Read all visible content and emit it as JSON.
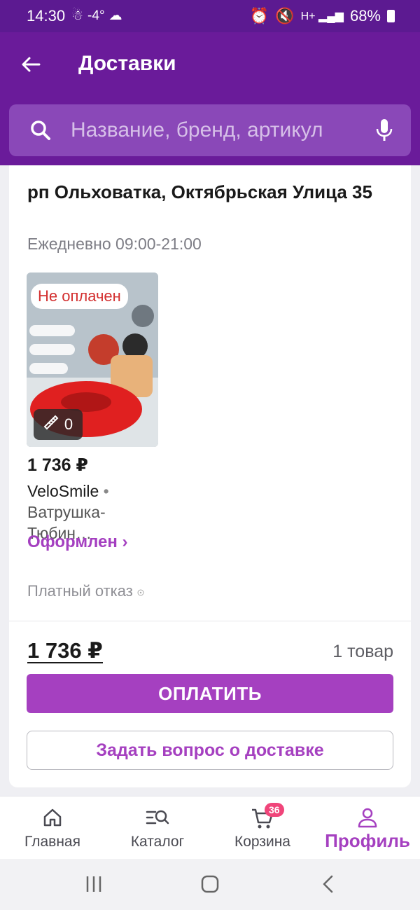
{
  "status_bar": {
    "time": "14:30",
    "temperature": "-4°",
    "battery": "68%"
  },
  "header": {
    "title": "Доставки"
  },
  "search": {
    "placeholder": "Название, бренд, артикул"
  },
  "delivery": {
    "address": "рп Ольховатка, Октябрьская Улица 35",
    "hours": "Ежедневно 09:00-21:00",
    "item": {
      "badge": "Не оплачен",
      "size_count": "0",
      "price": "1 736 ₽",
      "brand": "VeloSmile",
      "separator": "•",
      "name": "Ватрушка-Тюбин…",
      "status": "Оформлен ›"
    },
    "refusal": "Платный отказ",
    "total": "1 736 ₽",
    "items_count": "1 товар",
    "pay_label": "ОПЛАТИТЬ",
    "ask_label": "Задать вопрос о доставке"
  },
  "tabs": [
    {
      "label": "Главная",
      "icon": "home-icon"
    },
    {
      "label": "Каталог",
      "icon": "catalog-icon"
    },
    {
      "label": "Корзина",
      "icon": "cart-icon",
      "badge": "36"
    },
    {
      "label": "Профиль",
      "icon": "profile-icon",
      "active": true
    }
  ],
  "colors": {
    "header": "#6a1b9a",
    "accent": "#a540c0",
    "unpaid": "#d32f2f"
  }
}
